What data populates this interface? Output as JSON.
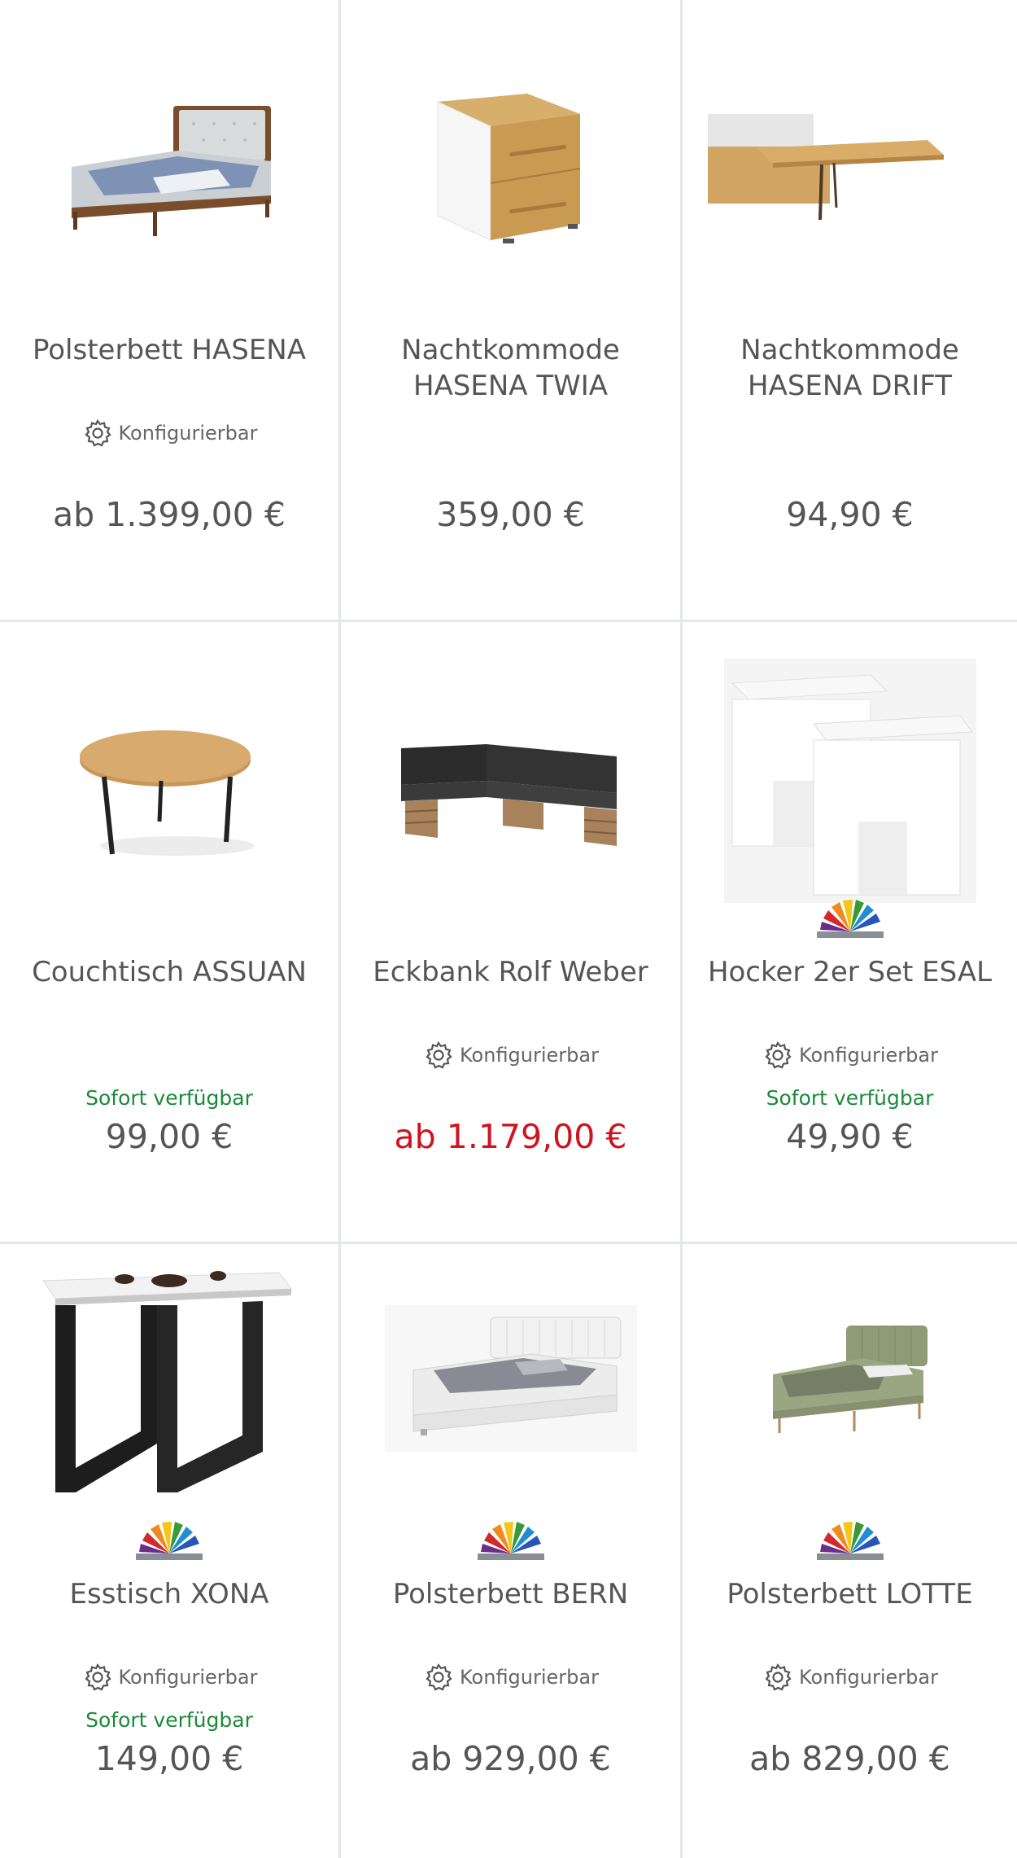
{
  "products": [
    {
      "title": "Polsterbett HASENA",
      "configurable": "Konfigurierbar",
      "availability": "",
      "price": "ab 1.399,00 €",
      "sale": false,
      "image": "upholstered-bed-wood-frame",
      "color_swatch": false
    },
    {
      "title": "Nachtkommode HASENA TWIA",
      "configurable": "",
      "availability": "",
      "price": "359,00 €",
      "sale": false,
      "image": "nightstand-two-drawers",
      "color_swatch": false
    },
    {
      "title": "Nachtkommode HASENA DRIFT",
      "configurable": "",
      "availability": "",
      "price": "94,90 €",
      "sale": false,
      "image": "floating-bedside-shelf",
      "color_swatch": false
    },
    {
      "title": "Couchtisch ASSUAN",
      "configurable": "",
      "availability": "Sofort verfügbar",
      "price": "99,00 €",
      "sale": false,
      "image": "round-coffee-table",
      "color_swatch": false
    },
    {
      "title": "Eckbank Rolf Weber",
      "configurable": "Konfigurierbar",
      "availability": "",
      "price": "ab 1.179,00 €",
      "sale": true,
      "image": "corner-bench",
      "color_swatch": false
    },
    {
      "title": "Hocker 2er Set ESAL",
      "configurable": "Konfigurierbar",
      "availability": "Sofort verfügbar",
      "price": "49,90 €",
      "sale": false,
      "image": "white-stool-set",
      "color_swatch": true
    },
    {
      "title": "Esstisch XONA",
      "configurable": "Konfigurierbar",
      "availability": "Sofort verfügbar",
      "price": "149,00 €",
      "sale": false,
      "image": "dining-table-black-frame",
      "color_swatch": true
    },
    {
      "title": "Polsterbett BERN",
      "configurable": "Konfigurierbar",
      "availability": "",
      "price": "ab 929,00 €",
      "sale": false,
      "image": "white-upholstered-bed",
      "color_swatch": true
    },
    {
      "title": "Polsterbett LOTTE",
      "configurable": "Konfigurierbar",
      "availability": "",
      "price": "ab 829,00 €",
      "sale": false,
      "image": "green-upholstered-bed",
      "color_swatch": true
    }
  ],
  "colors": {
    "price": "#555555",
    "sale_price": "#d0131d",
    "availability": "#1a8a3a",
    "divider": "#e5e8eb"
  }
}
